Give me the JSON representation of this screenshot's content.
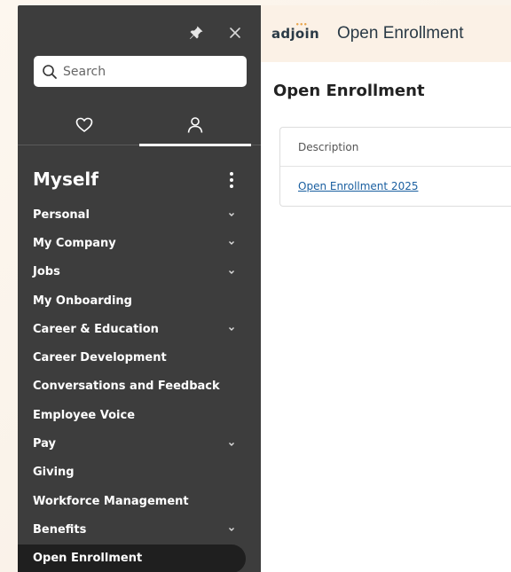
{
  "sidebar": {
    "search": {
      "placeholder": "Search"
    },
    "section_title": "Myself",
    "items": [
      {
        "label": "Personal",
        "chevron": true
      },
      {
        "label": "My Company",
        "chevron": true
      },
      {
        "label": "Jobs",
        "chevron": true
      },
      {
        "label": "My Onboarding",
        "chevron": false
      },
      {
        "label": "Career & Education",
        "chevron": true
      },
      {
        "label": "Career Development",
        "chevron": false
      },
      {
        "label": "Conversations and Feedback",
        "chevron": false
      },
      {
        "label": "Employee Voice",
        "chevron": false
      },
      {
        "label": "Pay",
        "chevron": true
      },
      {
        "label": "Giving",
        "chevron": false
      },
      {
        "label": "Workforce Management",
        "chevron": false
      },
      {
        "label": "Benefits",
        "chevron": true
      },
      {
        "label": "Open Enrollment",
        "chevron": false,
        "active": true
      }
    ]
  },
  "header": {
    "logo": "adjoin",
    "title": "Open Enrollment"
  },
  "main": {
    "page_title": "Open Enrollment",
    "table": {
      "columns": [
        "Description"
      ],
      "rows": [
        [
          "Open Enrollment 2025"
        ]
      ]
    }
  },
  "colors": {
    "sidebar_bg": "#3d3d3d",
    "active_item_bg": "#1f1f1f",
    "link": "#1a5fa0",
    "header_bg": "#fbf1e6",
    "logo_accent": "#e8a44a"
  },
  "icons": {
    "pin": "pin-icon",
    "close": "close-icon",
    "search": "search-icon",
    "favorites": "heart-icon",
    "profile": "person-icon",
    "more": "kebab-icon",
    "expand": "chevron-down-icon"
  }
}
